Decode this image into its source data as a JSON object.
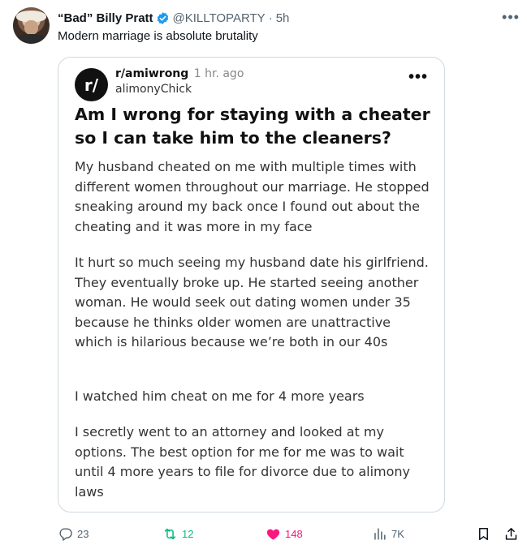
{
  "tweet": {
    "display_name": "“Bad” Billy Pratt",
    "handle": "@KILLTOPARTY",
    "separator": "·",
    "time": "5h",
    "text": "Modern marriage is absolute brutality"
  },
  "card": {
    "subreddit_logo_text": "r/",
    "subreddit": "r/amiwrong",
    "time": "1 hr. ago",
    "username": "alimonyChick",
    "more": "•••",
    "title": "Am I wrong for staying with a cheater so I can take him to the cleaners?",
    "paragraphs": [
      "My husband cheated on me with multiple times with different women throughout our marriage. He stopped sneaking around my back once I found out about the cheating and it was more in my face",
      "It hurt so much seeing my husband date his girlfriend. They eventually broke up. He started seeing another woman. He would seek out dating women under 35 because he thinks older women are unattractive which is hilarious because we’re both in our 40s",
      "I watched him cheat on me for 4 more years",
      "I secretly went to an attorney and looked at my options. The best option for me for me was to wait until 4 more years to file for divorce due to alimony laws"
    ]
  },
  "actions": {
    "replies": "23",
    "reposts": "12",
    "likes": "148",
    "views": "7K"
  },
  "icons": {
    "verified": "verified-badge-icon",
    "more": "more-icon",
    "reply": "reply-icon",
    "repost": "repost-icon",
    "like": "heart-icon",
    "views": "views-icon",
    "bookmark": "bookmark-icon",
    "share": "share-icon"
  },
  "colors": {
    "verified": "#1d9bf0",
    "repost": "#00ba7c",
    "like": "#f91880",
    "muted": "#536471"
  }
}
